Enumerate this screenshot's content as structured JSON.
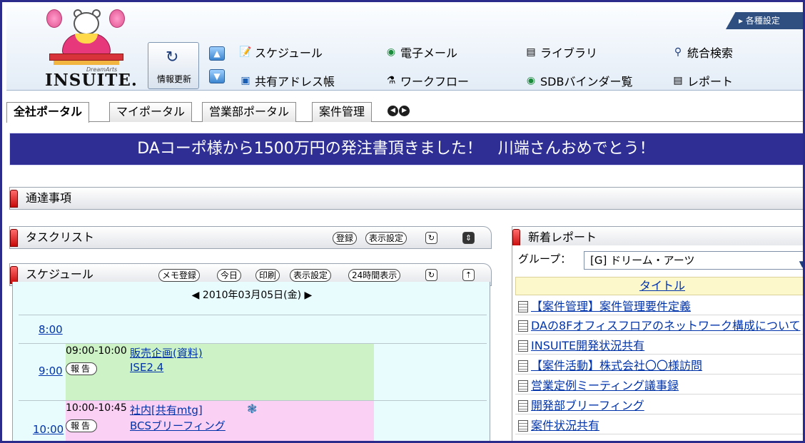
{
  "app": {
    "logo_small": "DreamArts",
    "logo_text": "INSUITE."
  },
  "header": {
    "refresh_label": "情報更新",
    "settings_label": "▸ 各種設定",
    "menu": [
      {
        "label": "スケジュール",
        "icon": "schedule-icon"
      },
      {
        "label": "電子メール",
        "icon": "email-icon"
      },
      {
        "label": "ライブラリ",
        "icon": "library-icon"
      },
      {
        "label": "統合検索",
        "icon": "search-icon"
      },
      {
        "label": "共有アドレス帳",
        "icon": "address-book-icon"
      },
      {
        "label": "ワークフロー",
        "icon": "workflow-icon"
      },
      {
        "label": "SDBバインダー覧",
        "icon": "sdb-icon"
      },
      {
        "label": "レポート",
        "icon": "report-icon"
      }
    ]
  },
  "tabs": [
    "全社ポータル",
    "マイポータル",
    "営業部ポータル",
    "案件管理"
  ],
  "banner": {
    "text": "DAコーポ様から1500万円の発注書頂きました！　川端さんおめでとう！"
  },
  "notice": {
    "title": "通達事項"
  },
  "tasklist": {
    "title": "タスクリスト",
    "register": "登録",
    "display_settings": "表示設定"
  },
  "schedule": {
    "title": "スケジュール",
    "buttons": {
      "memo": "メモ登録",
      "today": "今日",
      "print": "印刷",
      "display_settings": "表示設定",
      "hours24": "24時間表示"
    },
    "date": "2010年03月05日(金)",
    "hours": [
      "8:00",
      "9:00",
      "10:00"
    ],
    "report_label": "報告",
    "events": [
      {
        "time": "09:00-10:00",
        "title": "販売企画(資料)",
        "subtitle": "ISE2.4",
        "color": "#ccf2c6"
      },
      {
        "time": "10:00-10:45",
        "title": "社内[共有mtg]",
        "subtitle": "BCSブリーフィング",
        "color": "#fbd0f5"
      }
    ]
  },
  "reports": {
    "title": "新着レポート",
    "group_label": "グループ：",
    "group_value": "[G] ドリーム・アーツ",
    "column_title": "タイトル",
    "items": [
      "【案件管理】案件管理要件定義",
      "DAの8Fオフィスフロアのネットワーク構成について",
      "INSUITE開発状況共有",
      "【案件活動】株式会社〇〇様訪問",
      "営業定例ミーティング議事録",
      "開発部ブリーフィング",
      "案件状況共有"
    ]
  },
  "colors": {
    "banner": "#2e2e95",
    "accent_red": "#c90a0a",
    "link": "#0033aa"
  }
}
